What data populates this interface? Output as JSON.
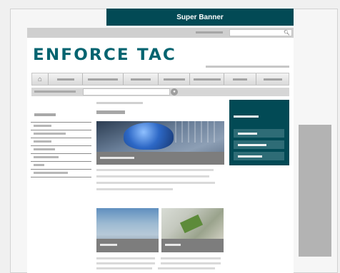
{
  "banner": {
    "label": "Super Banner",
    "color": "#024a55"
  },
  "logo": {
    "text": "ENFORCE TAC",
    "color": "#046470"
  },
  "topbar": {
    "search_icon": "search-icon"
  },
  "nav": {
    "home_icon": "home-icon",
    "items_count_visible": 8
  },
  "subbar": {
    "search_icon": "search-icon"
  },
  "colors": {
    "accent": "#024a55",
    "button": "#2e6c76",
    "caption": "#7d7d7d"
  }
}
